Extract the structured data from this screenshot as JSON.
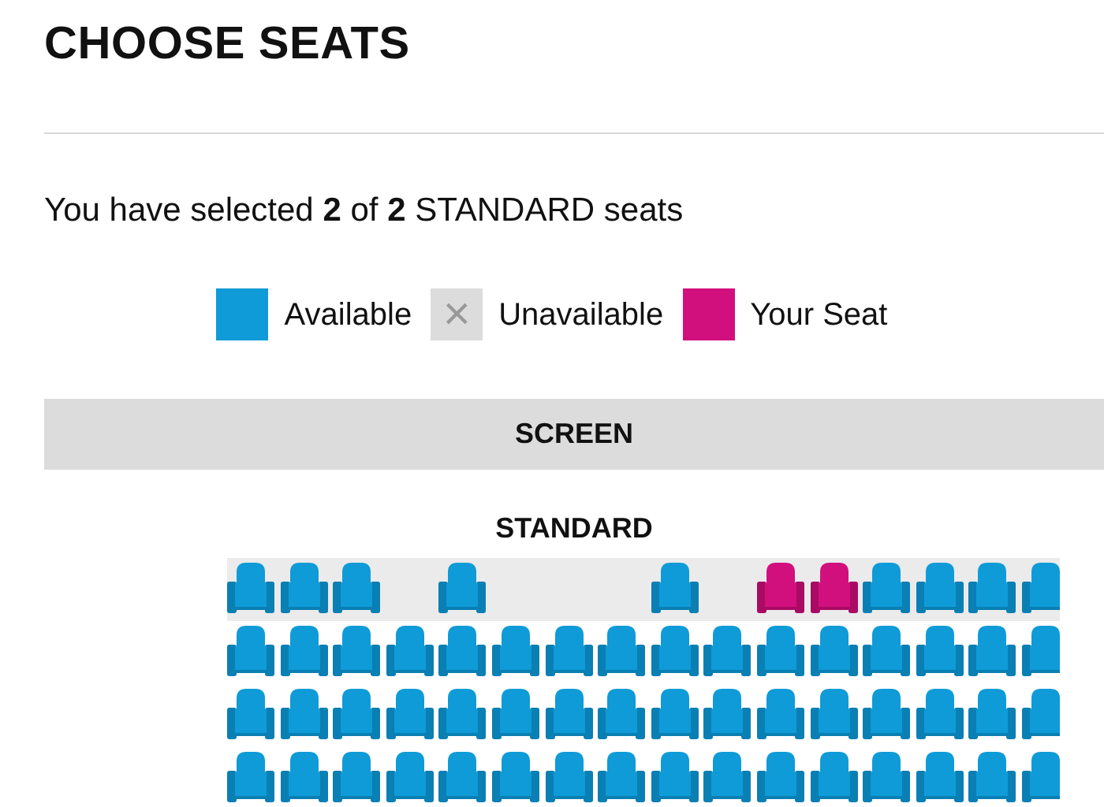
{
  "title": "CHOOSE SEATS",
  "summary": "You have selected **2** of **2** STANDARD seats",
  "legend": [
    {
      "label": "Available",
      "color": "#0f9bd7"
    },
    {
      "label": "Unavailable",
      "color": "#dcdcdc",
      "symbol": "×"
    },
    {
      "label": "Your Seat",
      "color": "#d1107e"
    }
  ],
  "screen_label": "SCREEN",
  "section_label": "STANDARD",
  "rows": [
    {
      "highlighted": true,
      "seats": [
        {
          "kind": "seat",
          "selected": false
        },
        {
          "kind": "seat",
          "selected": false
        },
        {
          "kind": "seat",
          "selected": false
        },
        {
          "kind": "gap"
        },
        {
          "kind": "seat",
          "selected": false
        },
        {
          "kind": "gap"
        },
        {
          "kind": "gap"
        },
        {
          "kind": "gap"
        },
        {
          "kind": "seat",
          "selected": false
        },
        {
          "kind": "gap"
        },
        {
          "kind": "seat",
          "selected": true
        },
        {
          "kind": "seat",
          "selected": true
        },
        {
          "kind": "seat",
          "selected": false
        },
        {
          "kind": "seat",
          "selected": false
        },
        {
          "kind": "seat",
          "selected": false
        },
        {
          "kind": "seat",
          "selected": false
        }
      ]
    },
    {
      "highlighted": false,
      "seats": [
        {
          "kind": "seat",
          "selected": false
        },
        {
          "kind": "seat",
          "selected": false
        },
        {
          "kind": "seat",
          "selected": false
        },
        {
          "kind": "seat",
          "selected": false
        },
        {
          "kind": "seat",
          "selected": false
        },
        {
          "kind": "seat",
          "selected": false
        },
        {
          "kind": "seat",
          "selected": false
        },
        {
          "kind": "seat",
          "selected": false
        },
        {
          "kind": "seat",
          "selected": false
        },
        {
          "kind": "seat",
          "selected": false
        },
        {
          "kind": "seat",
          "selected": false
        },
        {
          "kind": "seat",
          "selected": false
        },
        {
          "kind": "seat",
          "selected": false
        },
        {
          "kind": "seat",
          "selected": false
        },
        {
          "kind": "seat",
          "selected": false
        },
        {
          "kind": "seat",
          "selected": false
        }
      ]
    },
    {
      "highlighted": false,
      "seats": [
        {
          "kind": "seat",
          "selected": false
        },
        {
          "kind": "seat",
          "selected": false
        },
        {
          "kind": "seat",
          "selected": false
        },
        {
          "kind": "seat",
          "selected": false
        },
        {
          "kind": "seat",
          "selected": false
        },
        {
          "kind": "seat",
          "selected": false
        },
        {
          "kind": "seat",
          "selected": false
        },
        {
          "kind": "seat",
          "selected": false
        },
        {
          "kind": "seat",
          "selected": false
        },
        {
          "kind": "seat",
          "selected": false
        },
        {
          "kind": "seat",
          "selected": false
        },
        {
          "kind": "seat",
          "selected": false
        },
        {
          "kind": "seat",
          "selected": false
        },
        {
          "kind": "seat",
          "selected": false
        },
        {
          "kind": "seat",
          "selected": false
        },
        {
          "kind": "seat",
          "selected": false
        }
      ]
    },
    {
      "highlighted": false,
      "seats": [
        {
          "kind": "seat",
          "selected": false
        },
        {
          "kind": "seat",
          "selected": false
        },
        {
          "kind": "seat",
          "selected": false
        },
        {
          "kind": "seat",
          "selected": false
        },
        {
          "kind": "seat",
          "selected": false
        },
        {
          "kind": "seat",
          "selected": false
        },
        {
          "kind": "seat",
          "selected": false
        },
        {
          "kind": "seat",
          "selected": false
        },
        {
          "kind": "seat",
          "selected": false
        },
        {
          "kind": "seat",
          "selected": false
        },
        {
          "kind": "seat",
          "selected": false
        },
        {
          "kind": "seat",
          "selected": false
        },
        {
          "kind": "seat",
          "selected": false
        },
        {
          "kind": "seat",
          "selected": false
        },
        {
          "kind": "seat",
          "selected": false
        },
        {
          "kind": "seat",
          "selected": false
        }
      ]
    }
  ]
}
